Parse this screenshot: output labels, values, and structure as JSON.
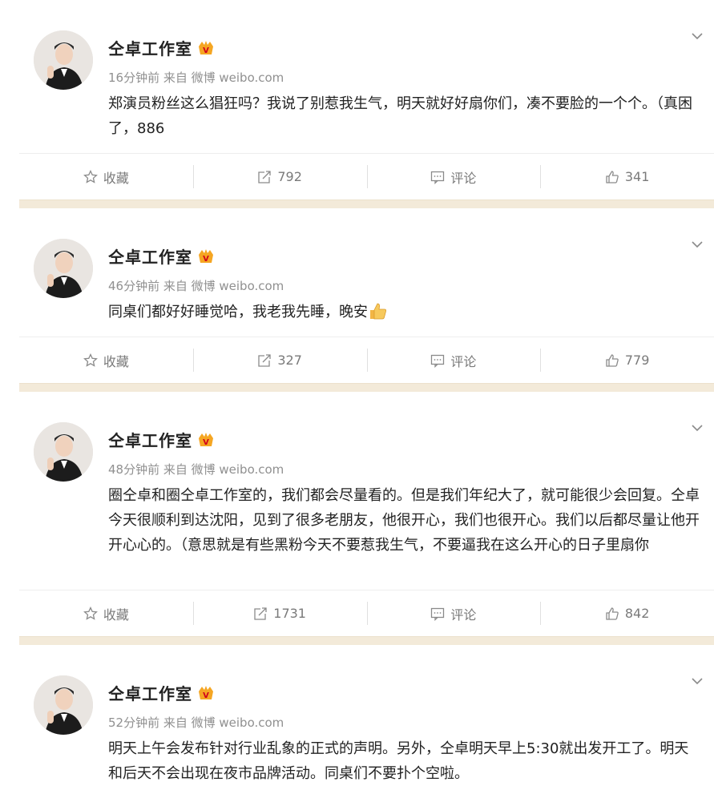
{
  "posts": [
    {
      "author": "仝卓工作室",
      "meta": "16分钟前 来自 微博 weibo.com",
      "text": "郑演员粉丝这么猖狂吗？我说了别惹我生气，明天就好好扇你们，凑不要脸的一个个。（真困了，886",
      "emoji": "",
      "actions": {
        "favorite": "收藏",
        "repost": "792",
        "comment": "评论",
        "like": "341"
      }
    },
    {
      "author": "仝卓工作室",
      "meta": "46分钟前 来自 微博 weibo.com",
      "text": "同桌们都好好睡觉哈，我老我先睡，晚安",
      "emoji": "thumbs-up",
      "actions": {
        "favorite": "收藏",
        "repost": "327",
        "comment": "评论",
        "like": "779"
      }
    },
    {
      "author": "仝卓工作室",
      "meta": "48分钟前 来自 微博 weibo.com",
      "text": "圈仝卓和圈仝卓工作室的，我们都会尽量看的。但是我们年纪大了，就可能很少会回复。仝卓今天很顺利到达沈阳，见到了很多老朋友，他很开心，我们也很开心。我们以后都尽量让他开开心心的。（意思就是有些黑粉今天不要惹我生气，不要逼我在这么开心的日子里扇你",
      "emoji": "",
      "actions": {
        "favorite": "收藏",
        "repost": "1731",
        "comment": "评论",
        "like": "842"
      }
    },
    {
      "author": "仝卓工作室",
      "meta": "52分钟前 来自 微博 weibo.com",
      "text": "明天上午会发布针对行业乱象的正式的声明。另外，仝卓明天早上5:30就出发开工了。明天和后天不会出现在夜市品牌活动。同桌们不要扑个空啦。",
      "emoji": "",
      "actions": null
    }
  ],
  "colors": {
    "divider_band": "#f3ead9",
    "badge": "#f5a623",
    "meta": "#909090"
  },
  "icons": [
    "star-icon",
    "repost-icon",
    "comment-icon",
    "like-icon",
    "chevron-down-icon",
    "verified-badge-icon"
  ]
}
